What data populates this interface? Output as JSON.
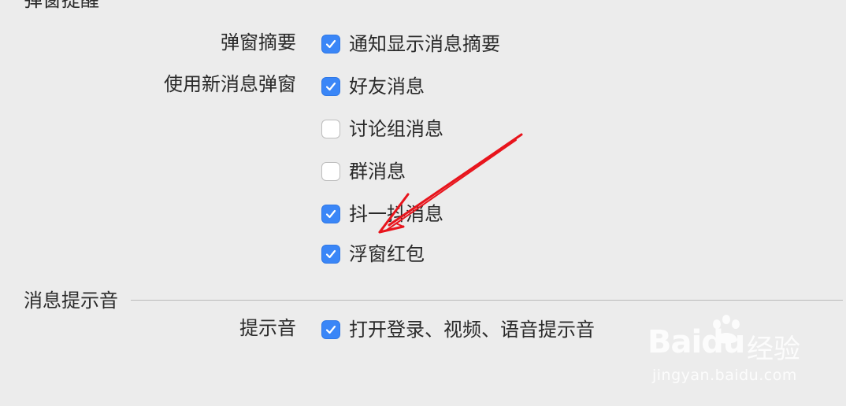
{
  "sections": {
    "popup": {
      "title": "弹窗提醒"
    },
    "sound": {
      "title": "消息提示音"
    }
  },
  "rows": {
    "popup_summary": {
      "label": "弹窗摘要"
    },
    "new_popup": {
      "label": "使用新消息弹窗"
    },
    "sound": {
      "label": "提示音"
    }
  },
  "options": [
    {
      "label": "通知显示消息摘要",
      "checked": true
    },
    {
      "label": "好友消息",
      "checked": true
    },
    {
      "label": "讨论组消息",
      "checked": false
    },
    {
      "label": "群消息",
      "checked": false
    },
    {
      "label": "抖一抖消息",
      "checked": true
    },
    {
      "label": "浮窗红包",
      "checked": true
    },
    {
      "label": "打开登录、视频、语音提示音",
      "checked": true
    }
  ],
  "colors": {
    "accent": "#3a86f7",
    "annotation": "#e8141c"
  },
  "watermark": {
    "logo": "Baidu",
    "cn": "经验",
    "url": "jingyan.baidu.com"
  }
}
